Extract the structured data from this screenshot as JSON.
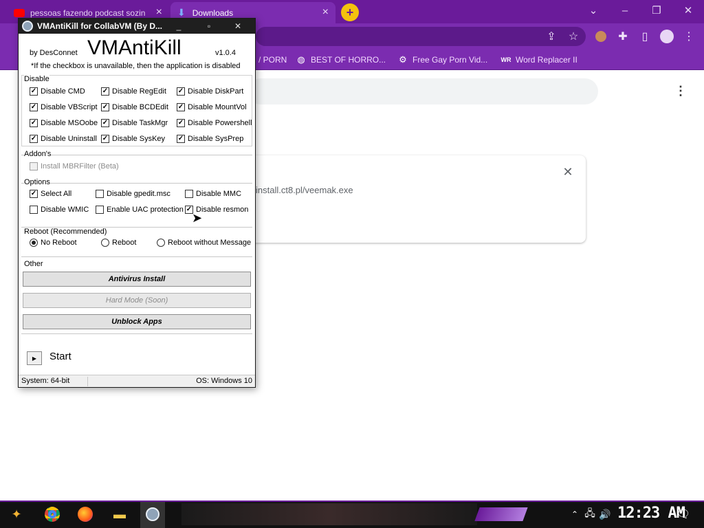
{
  "browser": {
    "tabs": [
      {
        "title": "pessoas fazendo podcast sozin",
        "favicon": "youtube-icon"
      },
      {
        "title": "Downloads",
        "favicon": "download-icon"
      }
    ],
    "new_tab_label": "+",
    "bookmarks": [
      {
        "label": "/ PORN",
        "icon": "bookmark-icon"
      },
      {
        "label": "BEST OF HORRO...",
        "icon": "globe-icon"
      },
      {
        "label": "Free Gay Porn Vid...",
        "icon": "bookmark-icon"
      },
      {
        "label": "Word Replacer II",
        "icon": "extension-icon"
      }
    ],
    "accent": "#7b2cb0",
    "downloads": {
      "url": "install.ct8.pl/veemak.exe"
    }
  },
  "app": {
    "window_title": "VMAntiKill for CollabVM (By D...",
    "heading": "VMAntiKill",
    "author": "by DesConnet",
    "version": "v1.0.4",
    "note": "*If the checkbox is unavailable, then the application is disabled",
    "disable_group": {
      "label": "Disable",
      "items": [
        {
          "label": "Disable CMD",
          "checked": true
        },
        {
          "label": "Disable RegEdit",
          "checked": true
        },
        {
          "label": "Disable DiskPart",
          "checked": true
        },
        {
          "label": "Disable VBScript",
          "checked": true
        },
        {
          "label": "Disable BCDEdit",
          "checked": true
        },
        {
          "label": "Disable MountVol",
          "checked": true
        },
        {
          "label": "Disable MSOobe",
          "checked": true
        },
        {
          "label": "Disable TaskMgr",
          "checked": true
        },
        {
          "label": "Disable Powershell",
          "checked": true
        },
        {
          "label": "Disable Uninstall",
          "checked": true
        },
        {
          "label": "Disable SysKey",
          "checked": true
        },
        {
          "label": "Disable SysPrep",
          "checked": true
        }
      ]
    },
    "addons_group": {
      "label": "Addon's",
      "items": [
        {
          "label": "Install MBRFilter (Beta)",
          "checked": false,
          "disabled": true
        }
      ]
    },
    "options_group": {
      "label": "Options",
      "items": [
        {
          "label": "Select All",
          "checked": true
        },
        {
          "label": "Disable gpedit.msc",
          "checked": false
        },
        {
          "label": "Disable MMC",
          "checked": false
        },
        {
          "label": "Disable WMIC",
          "checked": false
        },
        {
          "label": "Enable UAC protection",
          "checked": false
        },
        {
          "label": "Disable resmon",
          "checked": true
        }
      ]
    },
    "reboot_group": {
      "label": "Reboot (Recommended)",
      "items": [
        {
          "label": "No Reboot",
          "selected": true
        },
        {
          "label": "Reboot",
          "selected": false
        },
        {
          "label": "Reboot without Message",
          "selected": false
        }
      ]
    },
    "other_group": {
      "label": "Other",
      "buttons": [
        {
          "label": "Antivirus Install",
          "disabled": false
        },
        {
          "label": "Hard Mode (Soon)",
          "disabled": true
        },
        {
          "label": "Unblock Apps",
          "disabled": false
        }
      ]
    },
    "start_label": "Start",
    "status": {
      "system": "System: 64-bit",
      "os": "OS: Windows 10"
    }
  },
  "taskbar": {
    "clock": "12:23 AM",
    "apps": [
      "start-icon",
      "chrome-icon",
      "firefox-icon",
      "file-explorer-icon",
      "vmantikill-icon"
    ]
  }
}
